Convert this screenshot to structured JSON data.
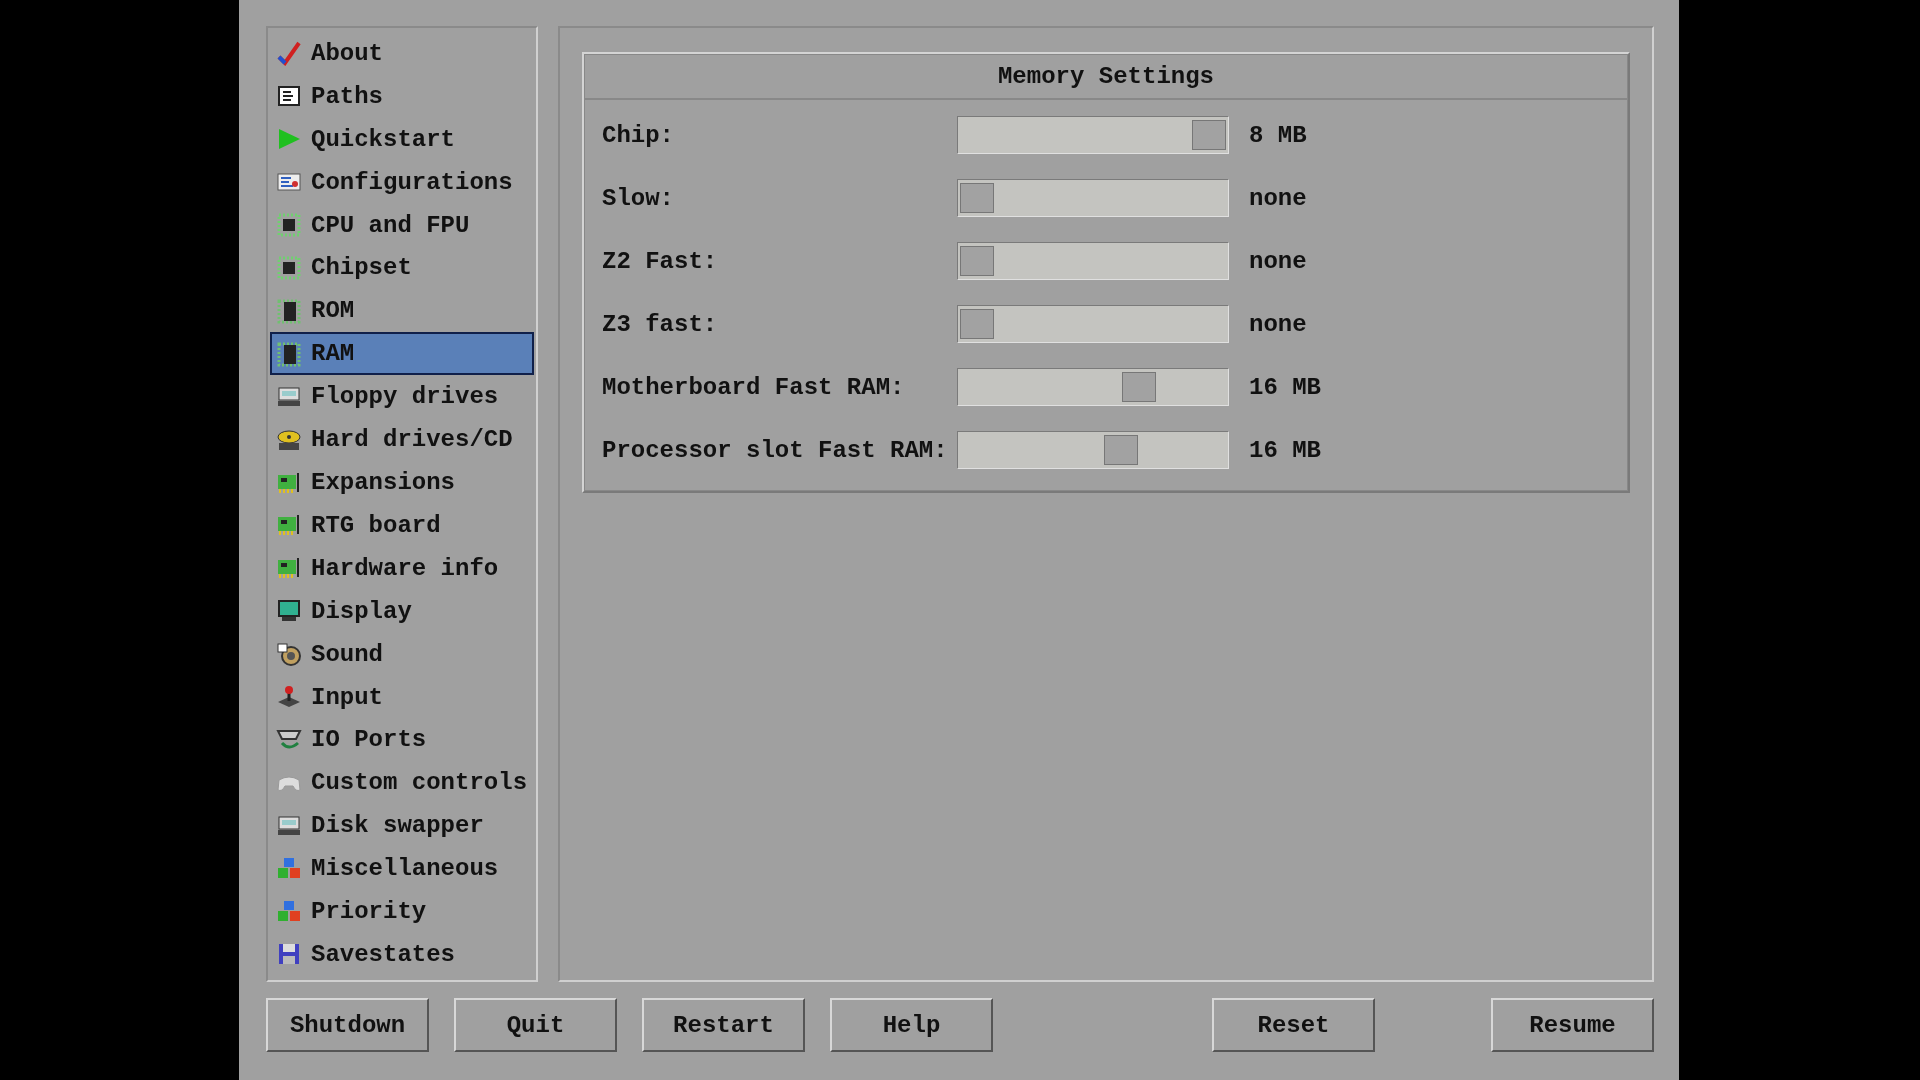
{
  "sidebar": {
    "items": [
      {
        "label": "About",
        "kind": "check",
        "selected": false
      },
      {
        "label": "Paths",
        "kind": "document",
        "selected": false
      },
      {
        "label": "Quickstart",
        "kind": "play",
        "selected": false
      },
      {
        "label": "Configurations",
        "kind": "form",
        "selected": false
      },
      {
        "label": "CPU and FPU",
        "kind": "chip",
        "selected": false
      },
      {
        "label": "Chipset",
        "kind": "chip",
        "selected": false
      },
      {
        "label": "ROM",
        "kind": "memory",
        "selected": false
      },
      {
        "label": "RAM",
        "kind": "memory",
        "selected": true
      },
      {
        "label": "Floppy drives",
        "kind": "drive",
        "selected": false
      },
      {
        "label": "Hard drives/CD",
        "kind": "harddisk",
        "selected": false
      },
      {
        "label": "Expansions",
        "kind": "card",
        "selected": false
      },
      {
        "label": "RTG board",
        "kind": "card",
        "selected": false
      },
      {
        "label": "Hardware info",
        "kind": "card",
        "selected": false
      },
      {
        "label": "Display",
        "kind": "monitor",
        "selected": false
      },
      {
        "label": "Sound",
        "kind": "speaker",
        "selected": false
      },
      {
        "label": "Input",
        "kind": "joystick",
        "selected": false
      },
      {
        "label": "IO Ports",
        "kind": "port",
        "selected": false
      },
      {
        "label": "Custom controls",
        "kind": "gamepad",
        "selected": false
      },
      {
        "label": "Disk swapper",
        "kind": "drive",
        "selected": false
      },
      {
        "label": "Miscellaneous",
        "kind": "blocks",
        "selected": false
      },
      {
        "label": "Priority",
        "kind": "blocks",
        "selected": false
      },
      {
        "label": "Savestates",
        "kind": "save",
        "selected": false
      }
    ]
  },
  "memory_settings": {
    "title": "Memory Settings",
    "sliders": [
      {
        "label": "Chip:",
        "level": 1,
        "reading": "8 MB"
      },
      {
        "label": "Slow:",
        "level": 0,
        "reading": "none"
      },
      {
        "label": "Z2 Fast:",
        "level": 0,
        "reading": "none"
      },
      {
        "label": "Z3 fast:",
        "level": 0,
        "reading": "none"
      },
      {
        "label": "Motherboard Fast RAM:",
        "level": 0.7,
        "reading": "16 MB"
      },
      {
        "label": "Processor slot Fast RAM:",
        "level": 0.62,
        "reading": "16 MB"
      }
    ]
  },
  "buttons_left": [
    "Shutdown",
    "Quit",
    "Restart",
    "Help"
  ],
  "buttons_right": [
    "Reset",
    "Resume"
  ]
}
